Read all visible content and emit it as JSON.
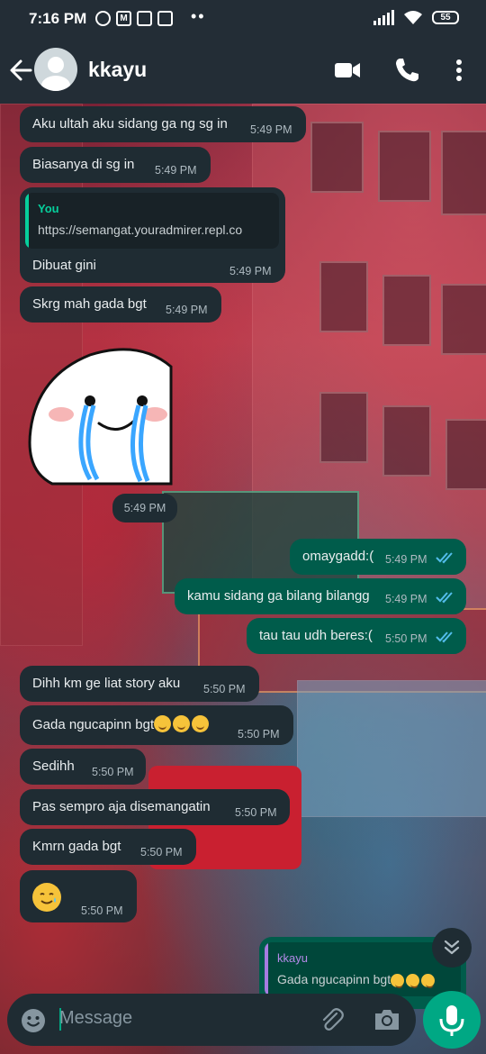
{
  "status_bar": {
    "time": "7:16 PM",
    "icons": [
      "alarm-icon",
      "gmail-icon",
      "app-icon",
      "photo-icon"
    ],
    "battery": "55"
  },
  "header": {
    "contact_name": "kkayu",
    "icons": [
      "back-arrow-icon",
      "avatar",
      "video-call-icon",
      "phone-icon",
      "more-icon"
    ]
  },
  "messages": [
    {
      "dir": "in",
      "text": "Aku ultah aku sidang ga ng sg in",
      "time": "5:49 PM"
    },
    {
      "dir": "in",
      "text": "Biasanya di sg in",
      "time": "5:49 PM"
    },
    {
      "dir": "in",
      "quote_name": "You",
      "quote_text": "https://semangat.youradmirer.repl.co",
      "text": "Dibuat gini",
      "time": "5:49 PM"
    },
    {
      "dir": "in",
      "text": "Skrg mah gada bgt",
      "time": "5:49 PM"
    },
    {
      "dir": "in",
      "type": "sticker",
      "time": "5:49 PM"
    },
    {
      "dir": "out",
      "text": "omaygadd:(",
      "time": "5:49 PM"
    },
    {
      "dir": "out",
      "text": "kamu sidang ga bilang bilangg",
      "time": "5:49 PM"
    },
    {
      "dir": "out",
      "text": "tau tau udh beres:(",
      "time": "5:50 PM"
    },
    {
      "dir": "in",
      "text": "Dihh km ge liat story aku",
      "time": "5:50 PM"
    },
    {
      "dir": "in",
      "text": "Gada ngucapinn bgt",
      "time": "5:50 PM"
    },
    {
      "dir": "in",
      "text": "Sedihh",
      "time": "5:50 PM"
    },
    {
      "dir": "in",
      "text": "Pas sempro aja disemangatin",
      "time": "5:50 PM"
    },
    {
      "dir": "in",
      "text": "Kmrn gada bgt",
      "time": "5:50 PM"
    },
    {
      "dir": "in",
      "type": "emoji",
      "time": "5:50 PM"
    },
    {
      "dir": "out",
      "quote_name": "kkayu",
      "quote_text": "Gada ngucapinn bgt"
    }
  ],
  "input": {
    "placeholder": "Message"
  },
  "colors": {
    "header_bg": "#232d36",
    "incoming_bubble": "#1f2c33",
    "outgoing_bubble": "#005c4b",
    "accent": "#00a884",
    "read_ticks": "#53bdeb"
  }
}
